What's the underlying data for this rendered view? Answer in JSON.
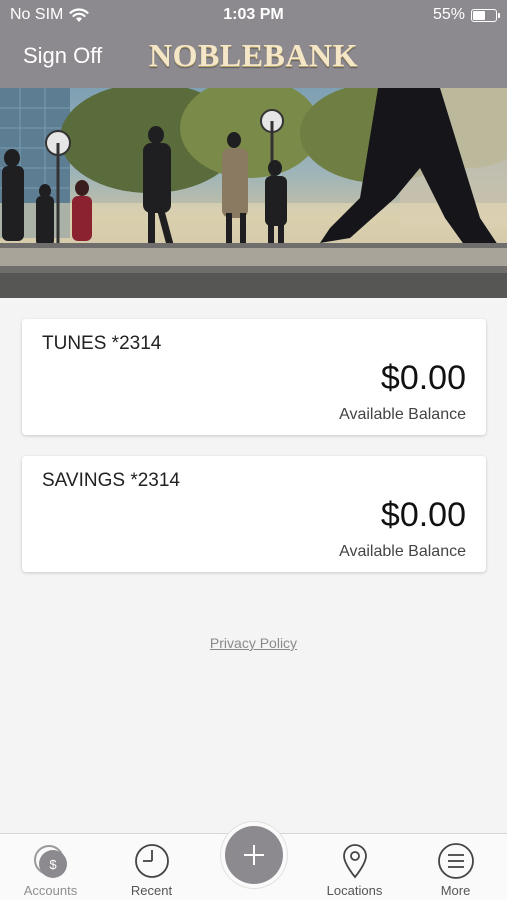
{
  "status_bar": {
    "carrier": "No SIM",
    "time": "1:03 PM",
    "battery_percent": "55%",
    "battery_level": 0.55
  },
  "header": {
    "sign_off_label": "Sign Off",
    "brand": "NOBLEBANK",
    "background_color": "#8d8a8f"
  },
  "accounts": [
    {
      "name": "TUNES *2314",
      "balance": "$0.00",
      "balance_label": "Available Balance"
    },
    {
      "name": "SAVINGS *2314",
      "balance": "$0.00",
      "balance_label": "Available Balance"
    }
  ],
  "privacy_policy_label": "Privacy Policy",
  "tabbar": {
    "items": [
      {
        "label": "Accounts",
        "icon": "accounts-icon"
      },
      {
        "label": "Recent",
        "icon": "clock-icon"
      },
      {
        "label": "Locations",
        "icon": "location-pin-icon"
      },
      {
        "label": "More",
        "icon": "menu-icon"
      }
    ],
    "center_button_icon": "plus-icon"
  }
}
